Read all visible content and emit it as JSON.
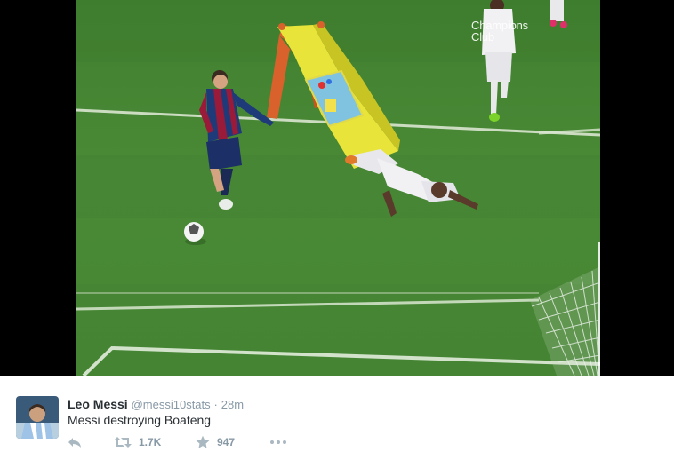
{
  "media": {
    "watermark_line1": "Champions",
    "watermark_line2": "Club"
  },
  "tweet": {
    "name": "Leo Messi",
    "handle": "@messi10stats",
    "separator": "·",
    "time": "28m",
    "text": "Messi destroying Boateng",
    "actions": {
      "reply_icon": "reply-icon",
      "retweet_icon": "retweet-icon",
      "retweet_count": "1.7K",
      "favorite_icon": "star-icon",
      "favorite_count": "947",
      "more_icon": "more-dots-icon"
    }
  },
  "colors": {
    "pitch": "#468734",
    "name": "#292f33",
    "muted": "#8899a6",
    "barca_blue": "#1f3a78",
    "barca_red": "#9a1a3a",
    "slide_yellow": "#e8e43a",
    "slide_orange": "#d9612b"
  }
}
